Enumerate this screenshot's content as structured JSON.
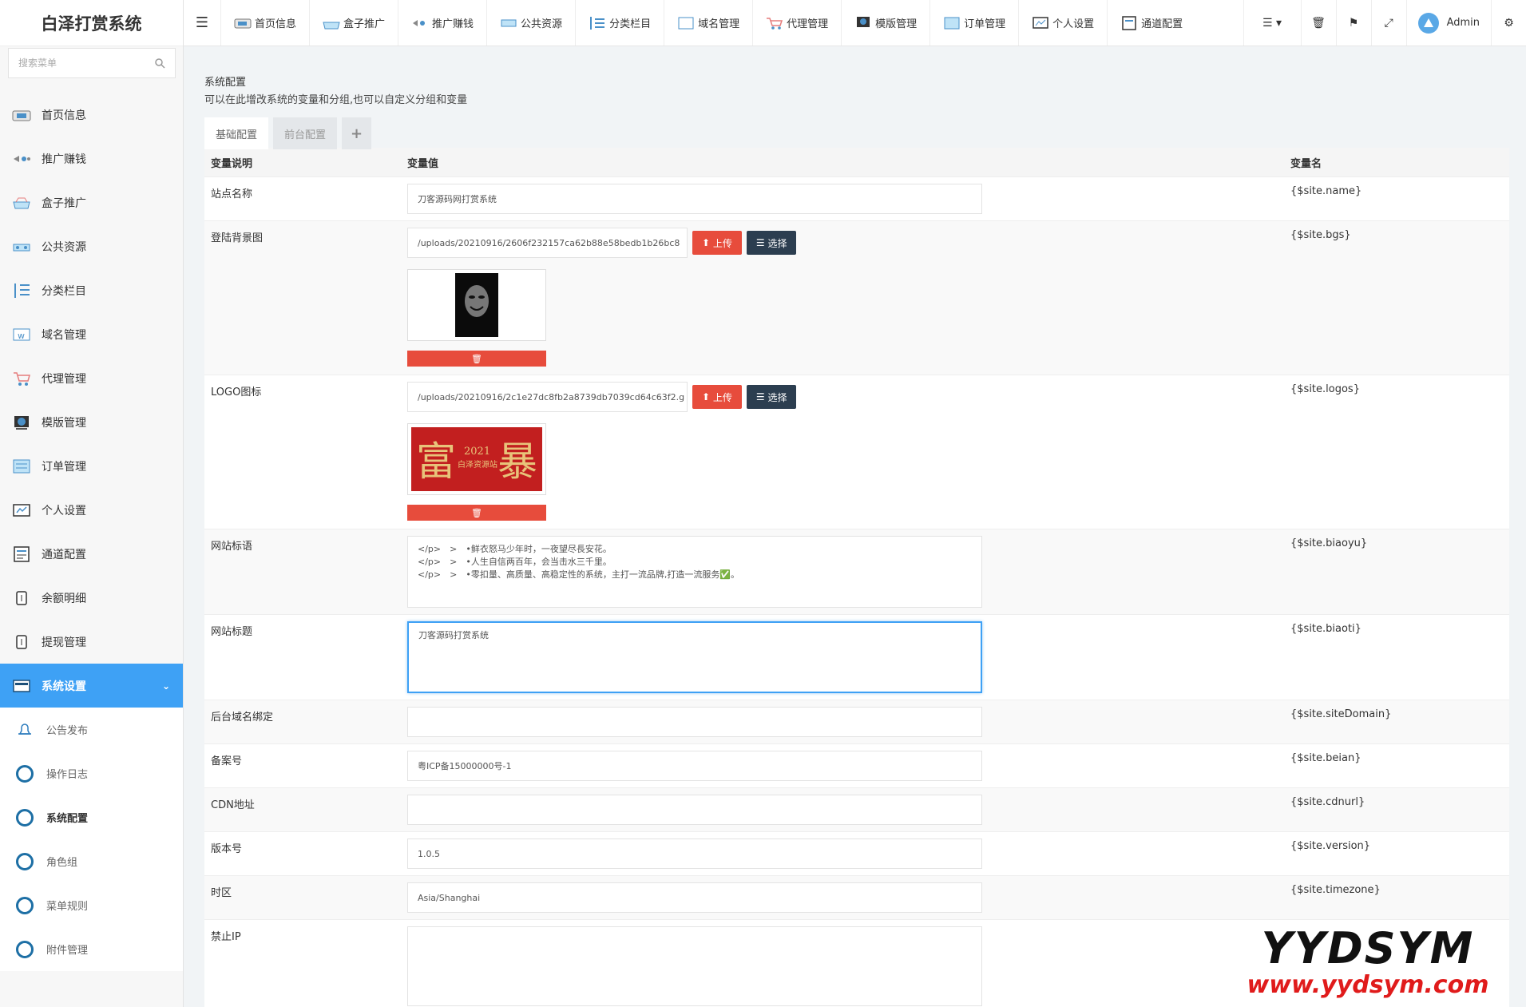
{
  "brand": "白泽打赏系统",
  "sidebar": {
    "search_placeholder": "搜索菜单",
    "items": [
      {
        "label": "首页信息",
        "icon": "dashboard-icon"
      },
      {
        "label": "推广赚钱",
        "icon": "promote-icon"
      },
      {
        "label": "盒子推广",
        "icon": "box-icon"
      },
      {
        "label": "公共资源",
        "icon": "resource-icon"
      },
      {
        "label": "分类栏目",
        "icon": "category-icon"
      },
      {
        "label": "域名管理",
        "icon": "domain-icon"
      },
      {
        "label": "代理管理",
        "icon": "cart-icon"
      },
      {
        "label": "模版管理",
        "icon": "template-icon"
      },
      {
        "label": "订单管理",
        "icon": "order-icon"
      },
      {
        "label": "个人设置",
        "icon": "profile-icon"
      },
      {
        "label": "通道配置",
        "icon": "channel-icon"
      },
      {
        "label": "余额明细",
        "icon": "balance-icon"
      },
      {
        "label": "提现管理",
        "icon": "withdraw-icon"
      }
    ],
    "active": {
      "label": "系统设置",
      "icon": "settings-icon"
    },
    "sub_items": [
      {
        "label": "公告发布"
      },
      {
        "label": "操作日志"
      },
      {
        "label": "系统配置"
      },
      {
        "label": "角色组"
      },
      {
        "label": "菜单规则"
      },
      {
        "label": "附件管理"
      }
    ]
  },
  "topbar": {
    "nav": [
      {
        "label": "首页信息"
      },
      {
        "label": "盒子推广"
      },
      {
        "label": "推广赚钱"
      },
      {
        "label": "公共资源"
      },
      {
        "label": "分类栏目"
      },
      {
        "label": "域名管理"
      },
      {
        "label": "代理管理"
      },
      {
        "label": "模版管理"
      },
      {
        "label": "订单管理"
      },
      {
        "label": "个人设置"
      },
      {
        "label": "通道配置"
      }
    ],
    "user": "Admin"
  },
  "panel": {
    "title": "系统配置",
    "desc": "可以在此增改系统的变量和分组,也可以自定义分组和变量",
    "tabs": [
      "基础配置",
      "前台配置",
      "+"
    ]
  },
  "table": {
    "headers": [
      "变量说明",
      "变量值",
      "变量名"
    ],
    "upload_label": "上传",
    "select_label": "选择",
    "rows": {
      "name": {
        "label": "站点名称",
        "value": "刀客源码网打赏系统",
        "var": "{$site.name}"
      },
      "bgs": {
        "label": "登陆背景图",
        "value": "/uploads/20210916/2606f232157ca62b88e58bedb1b26bc8",
        "var": "{$site.bgs}"
      },
      "logos": {
        "label": "LOGO图标",
        "value": "/uploads/20210916/2c1e27dc8fb2a8739db7039cd64c63f2.g",
        "var": "{$site.logos}",
        "logo_year": "2021",
        "logo_left": "富",
        "logo_right": "暴",
        "logo_sub": "白泽资源站"
      },
      "biaoyu": {
        "label": "网站标语",
        "line1": "</p>　>　•鲜衣怒马少年时，一夜望尽長安花。",
        "line2": "</p>　>　•人生自信两百年，会当击水三千里。",
        "line3": "</p>　>　•零扣量、高质量、高稳定性的系统，主打一流品牌,打造一流服务✅。",
        "var": "{$site.biaoyu}"
      },
      "biaoti": {
        "label": "网站标题",
        "value": "刀客源码打赏系统",
        "var": "{$site.biaoti}"
      },
      "siteDomain": {
        "label": "后台域名绑定",
        "value": "",
        "var": "{$site.siteDomain}"
      },
      "beian": {
        "label": "备案号",
        "value": "粤ICP备15000000号-1",
        "var": "{$site.beian}"
      },
      "cdnurl": {
        "label": "CDN地址",
        "value": "",
        "var": "{$site.cdnurl}"
      },
      "version": {
        "label": "版本号",
        "value": "1.0.5",
        "var": "{$site.version}"
      },
      "timezone": {
        "label": "时区",
        "value": "Asia/Shanghai",
        "var": "{$site.timezone}"
      },
      "forbiddenip": {
        "label": "禁止IP",
        "value": "",
        "var": ""
      }
    }
  },
  "watermark": {
    "line1": "YYDSYM",
    "line2": "www.yydsym.com"
  },
  "colors": {
    "accent": "#3ea1f5",
    "danger": "#e74c3c",
    "dark": "#2c3e50"
  }
}
